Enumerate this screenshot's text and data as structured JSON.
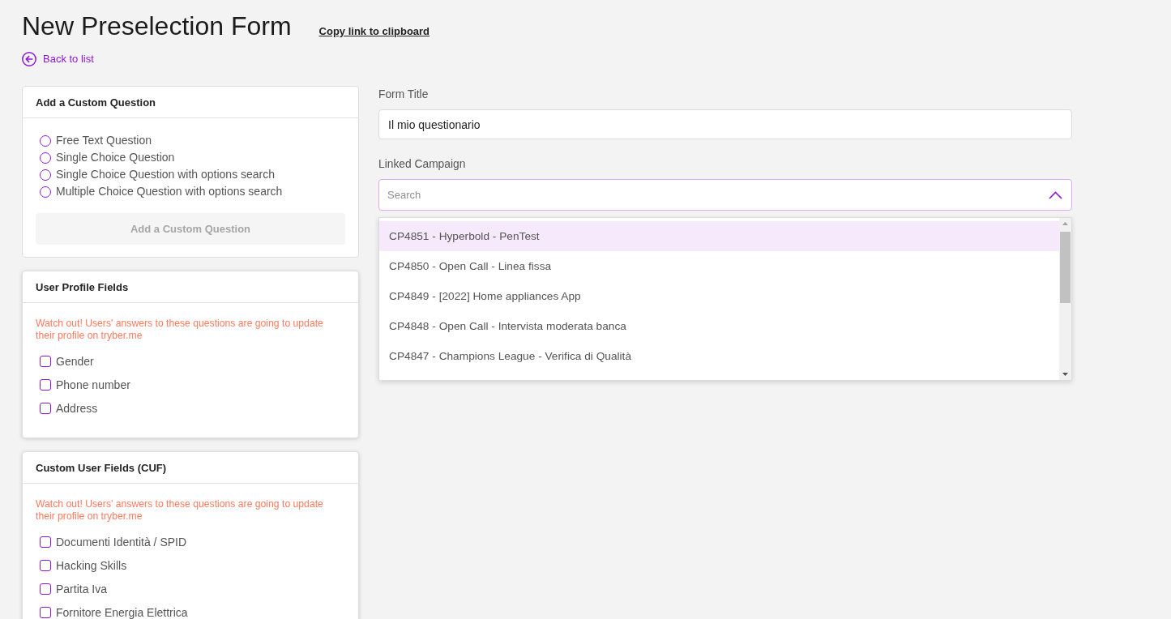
{
  "header": {
    "title": "New Preselection Form",
    "copy_link": "Copy link to clipboard",
    "back_link": "Back to list"
  },
  "custom_question": {
    "title": "Add a Custom Question",
    "options": [
      {
        "label": "Free Text Question",
        "selected": false
      },
      {
        "label": "Single Choice Question",
        "selected": false
      },
      {
        "label": "Single Choice Question with options search",
        "selected": false
      },
      {
        "label": "Multiple Choice Question with options search",
        "selected": false
      }
    ],
    "button": {
      "label": "Add a Custom Question",
      "disabled": true
    }
  },
  "user_profile_fields": {
    "title": "User Profile Fields",
    "warning": "Watch out! Users' answers to these questions are going to update their profile on tryber.me",
    "fields": [
      {
        "label": "Gender",
        "checked": false
      },
      {
        "label": "Phone number",
        "checked": false
      },
      {
        "label": "Address",
        "checked": false
      }
    ]
  },
  "custom_user_fields": {
    "title": "Custom User Fields (CUF)",
    "warning": "Watch out! Users' answers to these questions are going to update their profile on tryber.me",
    "fields": [
      {
        "label": "Documenti Identità / SPID",
        "checked": false
      },
      {
        "label": "Hacking Skills",
        "checked": false
      },
      {
        "label": "Partita Iva",
        "checked": false
      },
      {
        "label": "Fornitore Energia Elettrica",
        "checked": false
      }
    ]
  },
  "form_title": {
    "label": "Form Title",
    "value": "Il mio questionario"
  },
  "linked_campaign": {
    "label": "Linked Campaign",
    "placeholder": "Search",
    "expanded": true,
    "options": [
      {
        "label": "CP4851 - Hyperbold - PenTest",
        "selected": true
      },
      {
        "label": "CP4850 - Open Call - Linea fissa",
        "selected": false
      },
      {
        "label": "CP4849 - [2022] Home appliances App",
        "selected": false
      },
      {
        "label": "CP4848 - Open Call - Intervista moderata banca",
        "selected": false
      },
      {
        "label": "CP4847 - Champions League - Verifica di Qualità",
        "selected": false
      }
    ]
  }
}
